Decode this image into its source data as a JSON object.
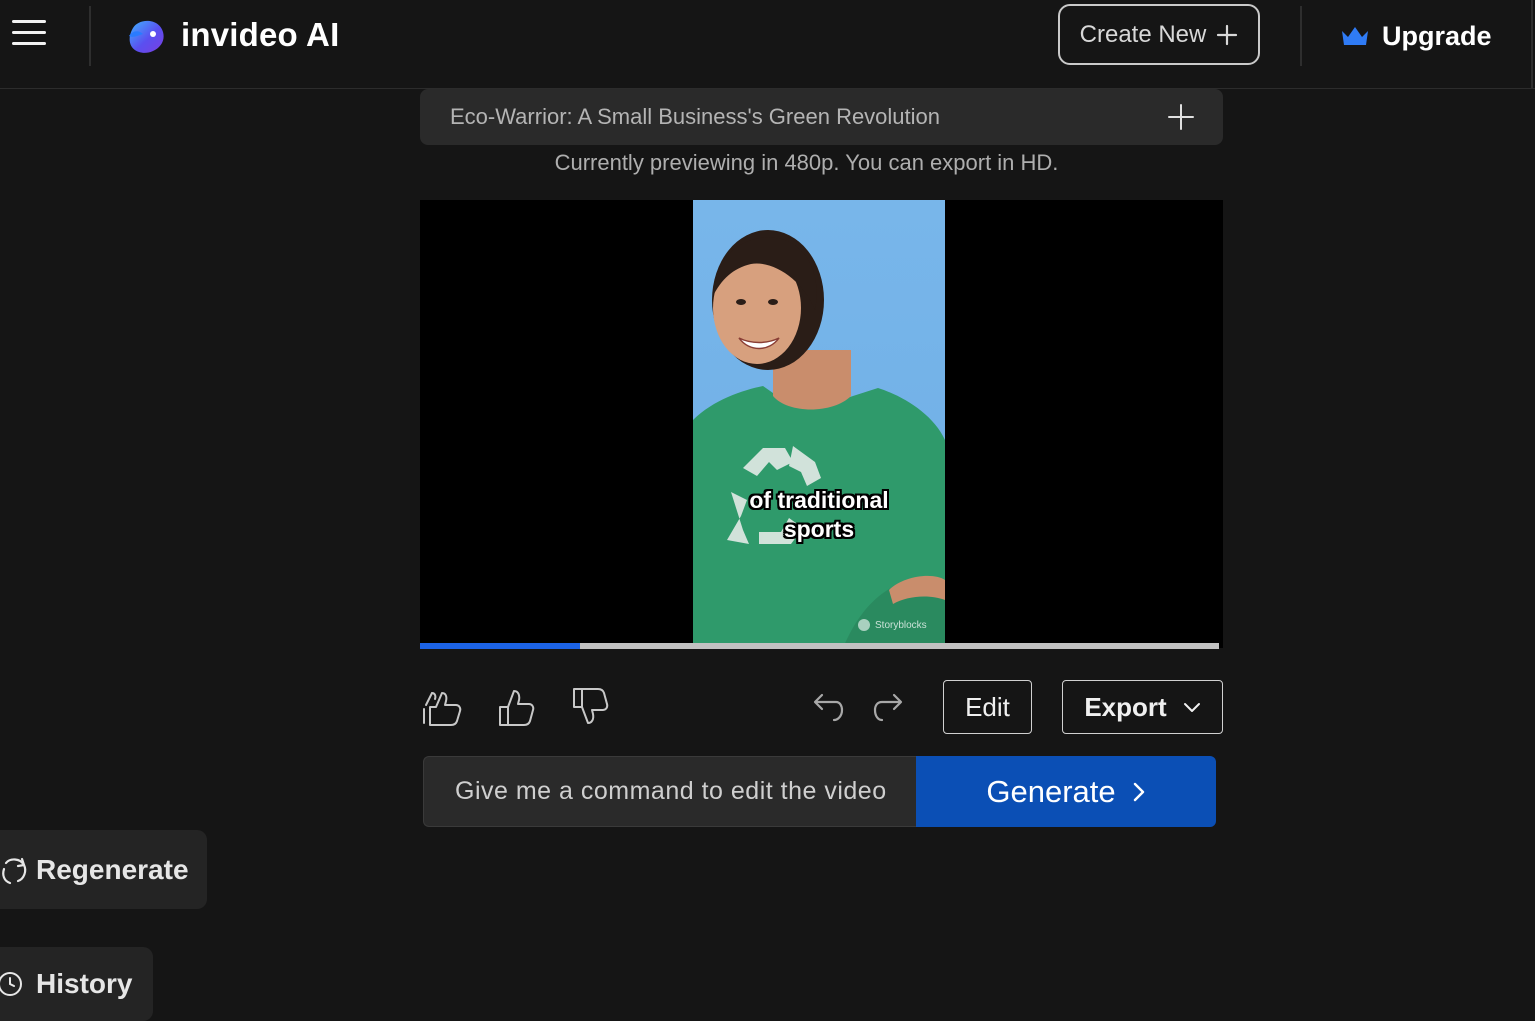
{
  "header": {
    "app_name": "invideo AI",
    "create_new_label": "Create New",
    "upgrade_label": "Upgrade"
  },
  "project": {
    "title": "Eco-Warrior: A Small Business's Green Revolution",
    "preview_note": "Currently previewing in 480p. You can export in HD."
  },
  "player": {
    "caption_line1": "of traditional",
    "caption_line2": "sports",
    "watermark": "Storyblocks",
    "progress_fraction": 0.2
  },
  "actions": {
    "edit_label": "Edit",
    "export_label": "Export"
  },
  "command": {
    "placeholder": "Give me a command to edit the video",
    "generate_label": "Generate"
  },
  "sidebar": {
    "regenerate_label": "Regenerate",
    "history_label": "History"
  },
  "colors": {
    "background": "#151515",
    "accent_blue": "#0b4fb5",
    "progress_blue": "#1c63e6",
    "crown_blue": "#2f7bf5"
  }
}
